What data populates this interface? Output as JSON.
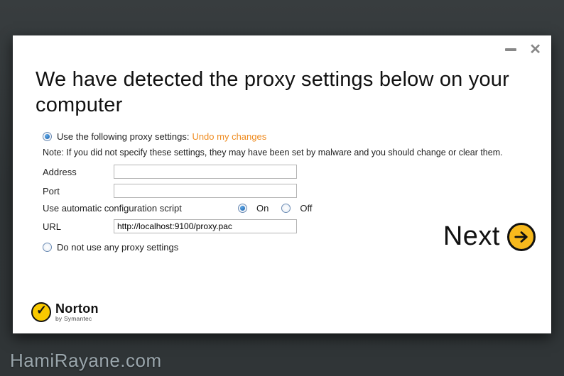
{
  "titlebar": {
    "minimize_icon": "minimize",
    "close_icon": "close"
  },
  "heading": "We have detected the proxy settings below on your computer",
  "form": {
    "use_proxy": {
      "label": "Use the following proxy settings:",
      "undo_link": "Undo my changes",
      "selected": true
    },
    "note": "Note: If you did not specify these settings, they may have been set by malware and you should change or clear them.",
    "address": {
      "label": "Address",
      "value": ""
    },
    "port": {
      "label": "Port",
      "value": ""
    },
    "auto_script": {
      "label": "Use automatic configuration script",
      "on_label": "On",
      "off_label": "Off",
      "value": "on"
    },
    "url": {
      "label": "URL",
      "value": "http://localhost:9100/proxy.pac"
    },
    "no_proxy": {
      "label": "Do not use any proxy settings",
      "selected": false
    }
  },
  "next": {
    "label": "Next"
  },
  "logo": {
    "brand": "Norton",
    "sub": "by Symantec"
  },
  "watermark": "HamiRayane.com"
}
